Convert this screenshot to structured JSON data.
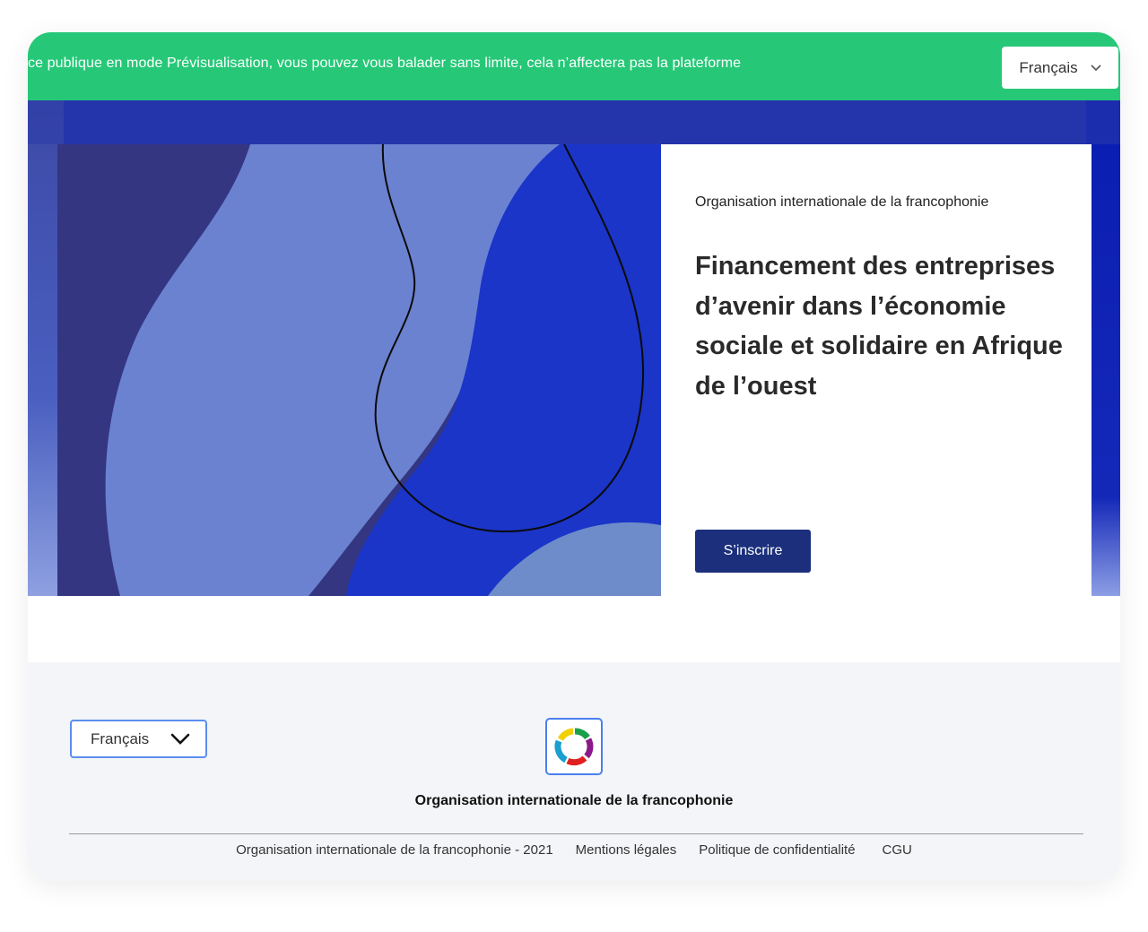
{
  "banner": {
    "text": "ce publique en mode Prévisualisation, vous pouvez vous balader sans limite, cela n’affectera pas la plateforme",
    "language_selected": "Français",
    "color": "#26c878"
  },
  "hero": {
    "organization": "Organisation internationale de la francophonie",
    "title": "Financement des entreprises d’avenir dans l’économie sociale et solidaire en Afrique de l’ouest",
    "cta_label": "S’inscrire",
    "cta_color": "#1b2f7c"
  },
  "footer": {
    "language_selected": "Français",
    "organization": "Organisation internationale de la francophonie",
    "links": [
      "Organisation internationale de la francophonie - 2021",
      "Mentions légales",
      "Politique de confidentialité",
      "CGU"
    ],
    "logo_icon": "francophonie-ring-icon"
  }
}
